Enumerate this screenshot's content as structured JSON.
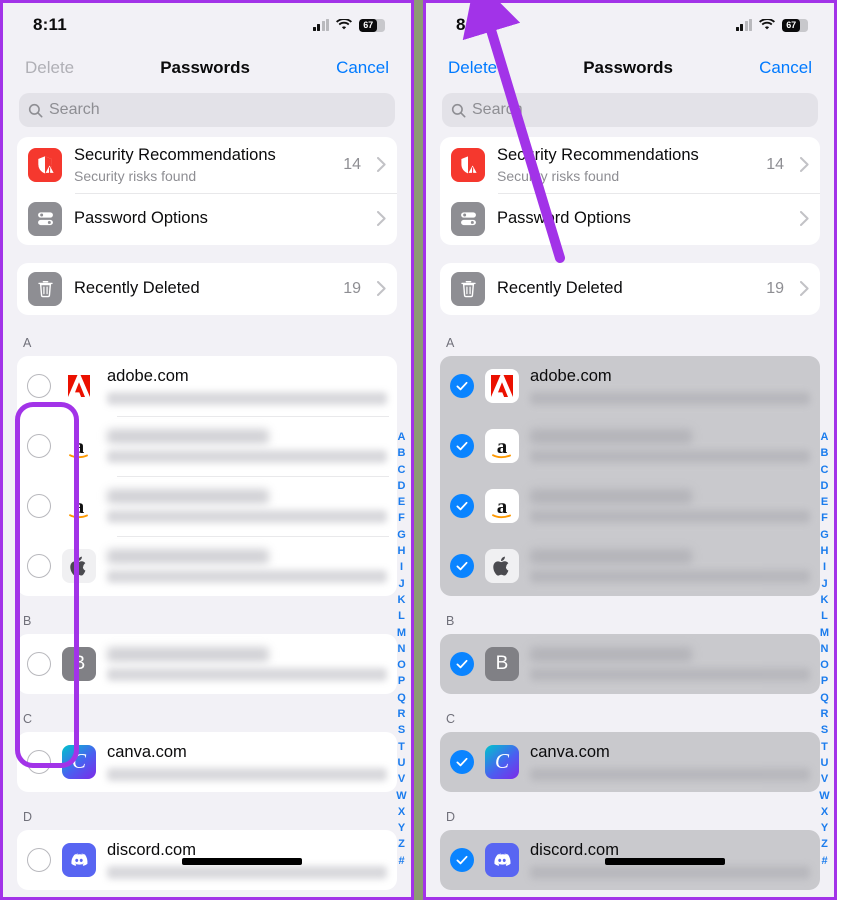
{
  "statusbar": {
    "time": "8:11",
    "battery_percent": "67",
    "signal_icon": "cellular-signal-icon",
    "wifi_icon": "wifi-icon",
    "battery_icon": "battery-icon"
  },
  "navbar": {
    "delete_label": "Delete",
    "title": "Passwords",
    "cancel_label": "Cancel"
  },
  "search": {
    "placeholder": "Search",
    "icon": "search-icon"
  },
  "top_card": {
    "rows": [
      {
        "title": "Security Recommendations",
        "subtitle": "Security risks found",
        "count": "14",
        "icon": "shield-warning-icon"
      },
      {
        "title": "Password Options",
        "subtitle": "",
        "count": "",
        "icon": "sliders-icon"
      }
    ]
  },
  "deleted_card": {
    "rows": [
      {
        "title": "Recently Deleted",
        "subtitle": "",
        "count": "19",
        "icon": "trash-icon"
      }
    ]
  },
  "groups": [
    {
      "letter": "A",
      "items": [
        {
          "name": "adobe.com",
          "blurred_name": false,
          "icon": "adobe-icon"
        },
        {
          "name": "",
          "blurred_name": true,
          "icon": "amazon-icon"
        },
        {
          "name": "",
          "blurred_name": true,
          "icon": "amazon-icon"
        },
        {
          "name": "",
          "blurred_name": true,
          "icon": "apple-icon"
        }
      ]
    },
    {
      "letter": "B",
      "items": [
        {
          "name": "",
          "blurred_name": true,
          "icon": "generic-b-icon"
        }
      ]
    },
    {
      "letter": "C",
      "items": [
        {
          "name": "canva.com",
          "blurred_name": false,
          "icon": "canva-icon"
        }
      ]
    },
    {
      "letter": "D",
      "items": [
        {
          "name": "discord.com",
          "blurred_name": false,
          "icon": "discord-icon"
        }
      ]
    }
  ],
  "alpha_index": [
    "A",
    "B",
    "C",
    "D",
    "E",
    "F",
    "G",
    "H",
    "I",
    "J",
    "K",
    "L",
    "M",
    "N",
    "O",
    "P",
    "Q",
    "R",
    "S",
    "T",
    "U",
    "V",
    "W",
    "X",
    "Y",
    "Z",
    "#"
  ],
  "annotations": {
    "highlight_label": "checkbox-column-highlight",
    "arrow_label": "delete-button-pointer-arrow",
    "color": "#a233e8"
  },
  "colors": {
    "accent_blue": "#007aff",
    "checked_blue": "#0a84ff",
    "annotation_purple": "#a233e8",
    "security_red": "#f5382e",
    "panel_bg": "#f2f1f6"
  }
}
